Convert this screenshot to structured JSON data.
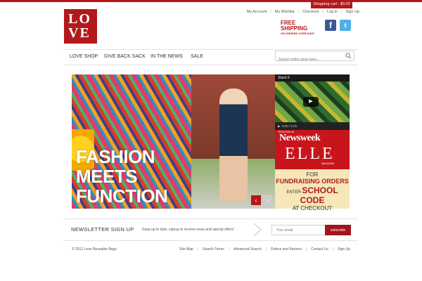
{
  "header": {
    "cart_label": "Shopping cart - $0.00",
    "logo_line1": "LO",
    "logo_line2": "VE",
    "top_links": [
      "My Account",
      "My Wishlist",
      "Checkout",
      "Log In",
      "Sign Up"
    ],
    "free_shipping": "FREE SHIPPING",
    "free_shipping_sub": "ON ORDERS OVER $100*",
    "facebook_glyph": "f",
    "twitter_glyph": "t"
  },
  "nav": {
    "items": [
      "LOVE SHOP",
      "GIVE BACK SACK",
      "IN THE NEWS",
      "SALE"
    ],
    "search_placeholder": "Search entire store here..."
  },
  "hero": {
    "headline_lines": [
      "FASHION",
      "MEETS",
      "FUNCTION"
    ],
    "prev_glyph": "‹",
    "next_glyph": "›"
  },
  "video": {
    "title": "Slash It",
    "time": "0:00 / 1:01"
  },
  "press": {
    "featured": "FEATURED IN",
    "newsweek": "Newsweek",
    "elle": "ELLE",
    "magazine": "MAGAZINE"
  },
  "fundraising": {
    "line1": "FOR",
    "line2": "FUNDRAISING ORDERS",
    "line3_prefix": "ENTER",
    "line3_code": "SCHOOL CODE",
    "line4": "AT CHECKOUT"
  },
  "newsletter": {
    "title": "NEWSLETTER SIGN UP",
    "description": "Keep up to date, signup to receive news and special offers!",
    "email_placeholder": "Your email",
    "subscribe_label": "subscribe"
  },
  "footer": {
    "copyright": "© 2012 Love Reusable Bags",
    "links": [
      "Site Map",
      "Search Terms",
      "Advanced Search",
      "Orders and Returns",
      "Contact Us",
      "Sign Up"
    ]
  },
  "colors": {
    "brand_red": "#b3191a",
    "subscribe_red": "#a3141c",
    "facebook_blue": "#3b5998",
    "twitter_blue": "#4fb1e3"
  },
  "icons": [
    "search-icon",
    "facebook-icon",
    "twitter-icon",
    "play-icon",
    "chevron-left-icon",
    "chevron-right-icon",
    "arrow-icon"
  ]
}
